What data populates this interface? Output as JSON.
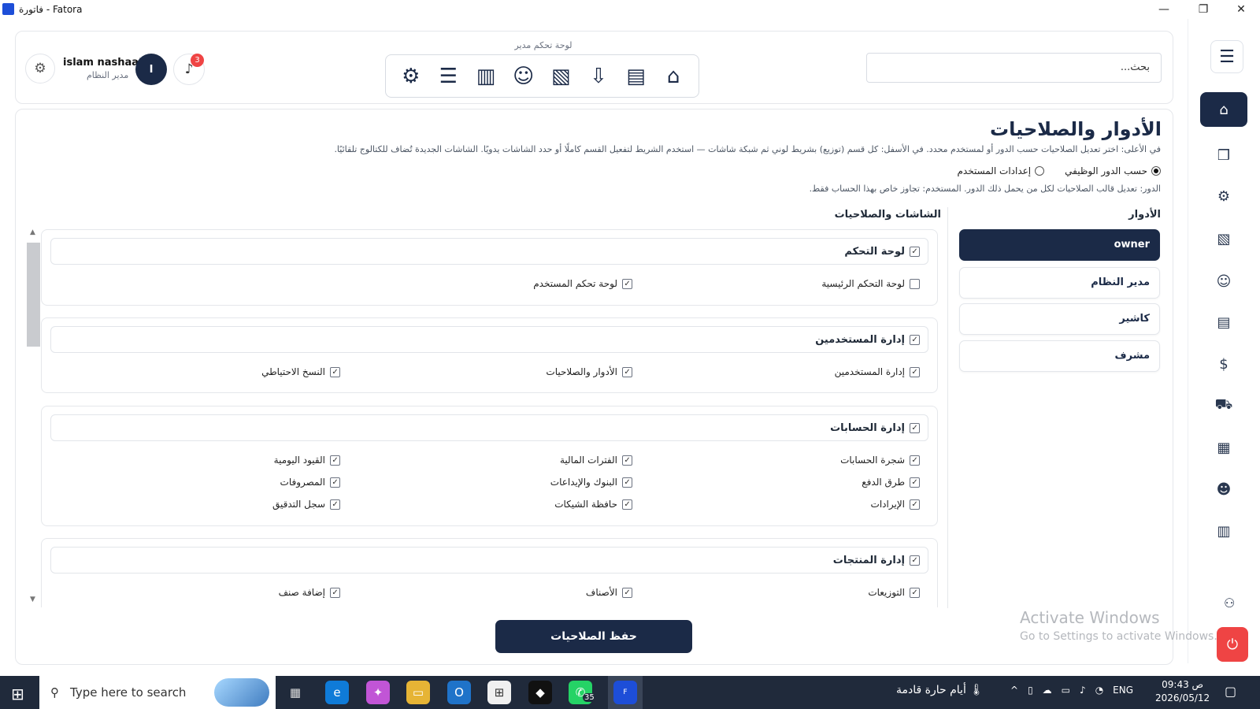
{
  "window": {
    "title": "فاتورة - Fatora",
    "minimize": "—",
    "maximize": "❐",
    "close": "✕"
  },
  "header": {
    "search_placeholder": "بحث...",
    "quick_label": "لوحة تحكم مدير",
    "user_name": "islam nashaat",
    "user_role": "مدير النظام",
    "avatar_initial": "I",
    "notifications_count": "3"
  },
  "page": {
    "title": "الأدوار والصلاحيات",
    "description": "في الأعلى: اختر تعديل الصلاحيات حسب الدور أو لمستخدم محدد. في الأسفل: كل قسم (توزيع) بشريط لوني ثم شبكة شاشات — استخدم الشريط لتفعيل القسم كاملًا أو حدد الشاشات يدويًا. الشاشات الجديدة تُضاف للكتالوج تلقائيًا.",
    "mode_role": "حسب الدور الوظيفي",
    "mode_user": "إعدادات المستخدم",
    "hint": "الدور: تعديل قالب الصلاحيات لكل من يحمل ذلك الدور. المستخدم: تجاوز خاص بهذا الحساب فقط.",
    "roles_heading": "الأدوار",
    "screens_heading": "الشاشات والصلاحيات",
    "save_label": "حفظ الصلاحيات"
  },
  "roles": [
    "owner",
    "مدير النظام",
    "كاشير",
    "مشرف"
  ],
  "sections": [
    {
      "title": "لوحة التحكم",
      "items": [
        "لوحة التحكم الرئيسية",
        "لوحة تحكم المستخدم"
      ],
      "checks": [
        false,
        true
      ]
    },
    {
      "title": "إدارة المستخدمين",
      "items": [
        "إدارة المستخدمين",
        "الأدوار والصلاحيات",
        "النسخ الاحتياطي"
      ],
      "checks": [
        true,
        true,
        true
      ]
    },
    {
      "title": "إدارة الحسابات",
      "items": [
        "شجرة الحسابات",
        "الفترات المالية",
        "القيود اليومية",
        "طرق الدفع",
        "البنوك والإيداعات",
        "المصروفات",
        "الإيرادات",
        "حافظة الشيكات",
        "سجل التدقيق"
      ],
      "checks": [
        true,
        true,
        true,
        true,
        true,
        true,
        true,
        true,
        true
      ]
    },
    {
      "title": "إدارة المنتجات",
      "items": [
        "التوزيعات",
        "الأصناف",
        "إضافة صنف"
      ],
      "checks": [
        true,
        true,
        true
      ]
    }
  ],
  "watermark": {
    "line1": "Activate Windows",
    "line2": "Go to Settings to activate Windows."
  },
  "taskbar": {
    "search_placeholder": "Type here to search",
    "whatsapp_badge": "35",
    "weather": "أيام حارة قادمة",
    "lang": "ENG",
    "time": "09:43 ص",
    "date": "2026/05/12"
  }
}
